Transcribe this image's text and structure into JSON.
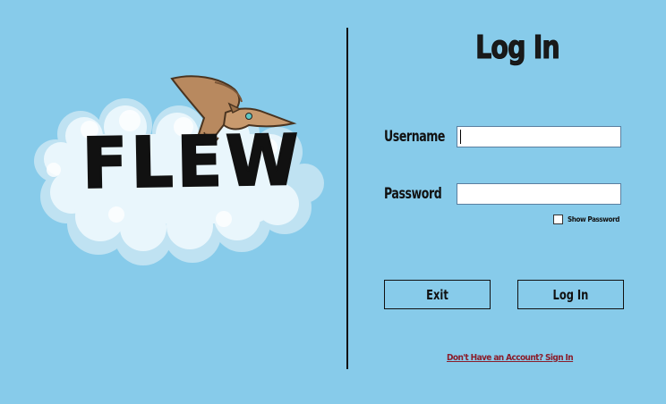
{
  "logo": {
    "wordmark": "FLEW"
  },
  "login": {
    "title": "Log In",
    "username_label": "Username",
    "username_value": "",
    "password_label": "Password",
    "password_value": "",
    "show_password_label": "Show Password",
    "show_password_checked": false,
    "exit_label": "Exit",
    "login_label": "Log In",
    "signup_link": "Don't Have an Account? Sign In"
  },
  "colors": {
    "background": "#87cbea",
    "cloud": "#e9f6fc",
    "cloud_shadow": "#bfe2f2",
    "pterodactyl": "#b8895f",
    "link": "#8a1d2b"
  }
}
